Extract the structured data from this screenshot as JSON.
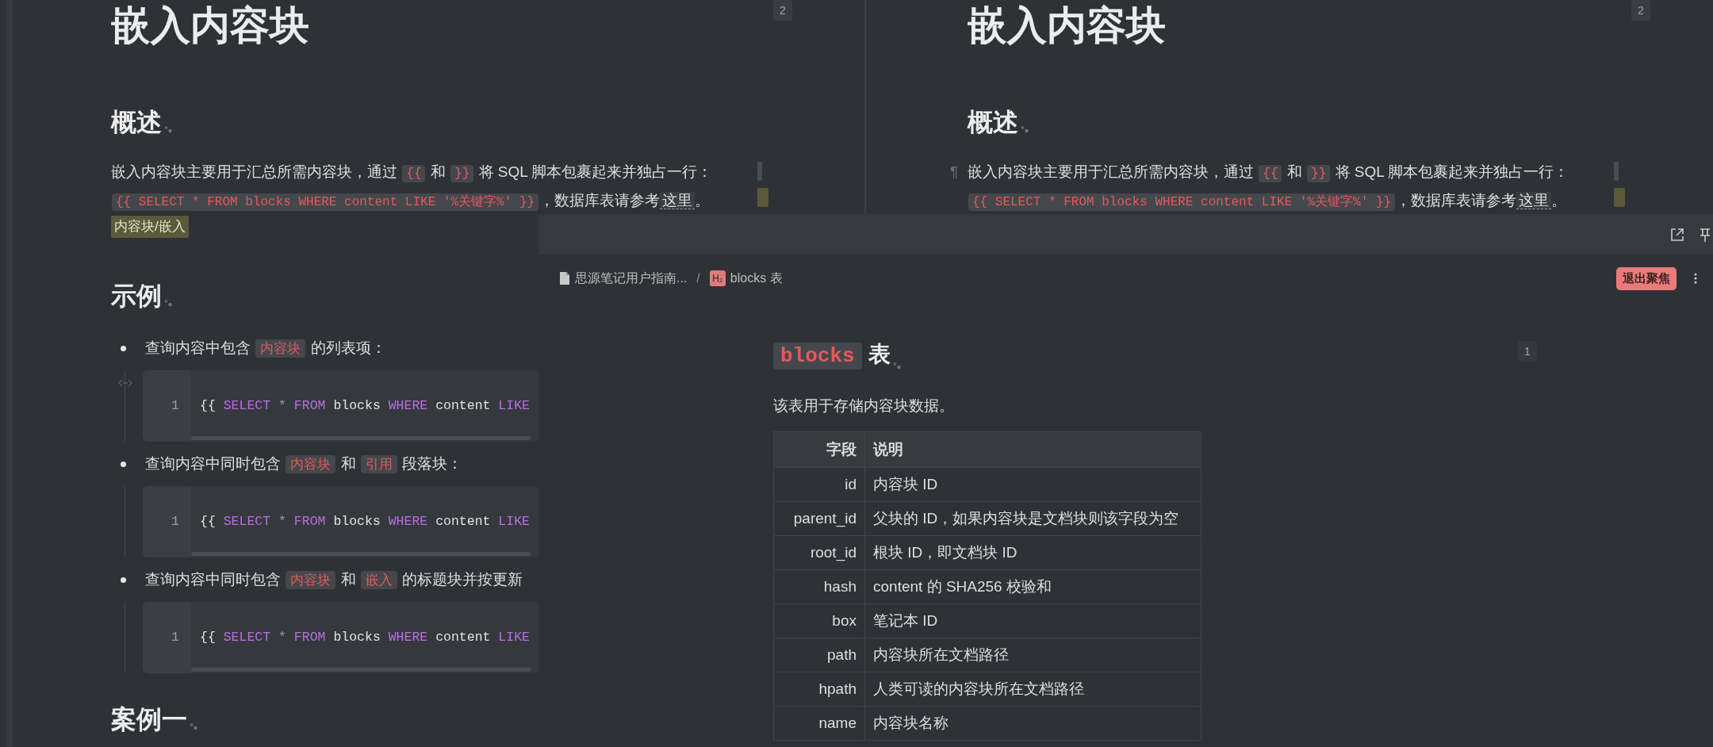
{
  "panes": [
    {
      "page_number": "2",
      "title": "嵌入内容块",
      "blocks": [
        {
          "kind": "heading",
          "text": "概述"
        },
        {
          "kind": "paragraph",
          "segments": [
            {
              "kind": "text",
              "text": "嵌入内容块主要用于汇总所需内容块，通过 "
            },
            {
              "kind": "code",
              "text": "{{"
            },
            {
              "kind": "text",
              "text": " 和 "
            },
            {
              "kind": "code",
              "text": "}}"
            },
            {
              "kind": "text",
              "text": " 将 SQL 脚本包裹起来并独占一行："
            },
            {
              "kind": "code",
              "text": "{{ SELECT * FROM blocks WHERE content LIKE '%关键字%' }}"
            },
            {
              "kind": "text",
              "text": "，数据库表请参考"
            },
            {
              "kind": "ref",
              "text": "这里"
            },
            {
              "kind": "text",
              "text": "。"
            }
          ],
          "markers": [
            {
              "kind": "block"
            },
            {
              "kind": "tag"
            }
          ]
        },
        {
          "kind": "tag",
          "text": "内容块/嵌入"
        },
        {
          "kind": "heading",
          "text": "示例"
        },
        {
          "kind": "list",
          "items": [
            {
              "hovered": true,
              "segments": [
                {
                  "kind": "text",
                  "text": "查询内容中包含 "
                },
                {
                  "kind": "code",
                  "text": "内容块"
                },
                {
                  "kind": "text",
                  "text": " 的列表项："
                }
              ],
              "code": {
                "line_number": "1",
                "tokens": [
                  {
                    "kind": "plain",
                    "text": "{{"
                  },
                  {
                    "kind": "keyword",
                    "text": "SELECT"
                  },
                  {
                    "kind": "operator",
                    "text": "*"
                  },
                  {
                    "kind": "keyword",
                    "text": "FROM"
                  },
                  {
                    "kind": "plain",
                    "text": "blocks"
                  },
                  {
                    "kind": "keyword",
                    "text": "WHERE"
                  },
                  {
                    "kind": "plain",
                    "text": "content"
                  },
                  {
                    "kind": "keyword",
                    "text": "LIKE"
                  }
                ]
              }
            },
            {
              "hovered": false,
              "segments": [
                {
                  "kind": "text",
                  "text": "查询内容中同时包含 "
                },
                {
                  "kind": "code",
                  "text": "内容块"
                },
                {
                  "kind": "text",
                  "text": " 和 "
                },
                {
                  "kind": "code",
                  "text": "引用"
                },
                {
                  "kind": "text",
                  "text": " 段落块："
                }
              ],
              "code": {
                "line_number": "1",
                "tokens": [
                  {
                    "kind": "plain",
                    "text": "{{"
                  },
                  {
                    "kind": "keyword",
                    "text": "SELECT"
                  },
                  {
                    "kind": "operator",
                    "text": "*"
                  },
                  {
                    "kind": "keyword",
                    "text": "FROM"
                  },
                  {
                    "kind": "plain",
                    "text": "blocks"
                  },
                  {
                    "kind": "keyword",
                    "text": "WHERE"
                  },
                  {
                    "kind": "plain",
                    "text": "content"
                  },
                  {
                    "kind": "keyword",
                    "text": "LIKE"
                  }
                ]
              }
            },
            {
              "hovered": false,
              "segments": [
                {
                  "kind": "text",
                  "text": "查询内容中同时包含 "
                },
                {
                  "kind": "code",
                  "text": "内容块"
                },
                {
                  "kind": "text",
                  "text": " 和 "
                },
                {
                  "kind": "code",
                  "text": "嵌入"
                },
                {
                  "kind": "text",
                  "text": " 的标题块并按更新"
                }
              ],
              "code": {
                "line_number": "1",
                "tokens": [
                  {
                    "kind": "plain",
                    "text": "{{"
                  },
                  {
                    "kind": "keyword",
                    "text": "SELECT"
                  },
                  {
                    "kind": "operator",
                    "text": "*"
                  },
                  {
                    "kind": "keyword",
                    "text": "FROM"
                  },
                  {
                    "kind": "plain",
                    "text": "blocks"
                  },
                  {
                    "kind": "keyword",
                    "text": "WHERE"
                  },
                  {
                    "kind": "plain",
                    "text": "content"
                  },
                  {
                    "kind": "keyword",
                    "text": "LIKE"
                  }
                ]
              }
            }
          ]
        },
        {
          "kind": "heading",
          "text": "案例一"
        }
      ]
    },
    {
      "page_number": "2",
      "title": "嵌入内容块",
      "blocks": [
        {
          "kind": "heading",
          "text": "概述"
        },
        {
          "kind": "paragraph",
          "gutter_mark": "¶",
          "segments": [
            {
              "kind": "text",
              "text": "嵌入内容块主要用于汇总所需内容块，通过 "
            },
            {
              "kind": "code",
              "text": "{{"
            },
            {
              "kind": "text",
              "text": " 和 "
            },
            {
              "kind": "code",
              "text": "}}"
            },
            {
              "kind": "text",
              "text": " 将 SQL 脚本包裹起来并独占一行："
            },
            {
              "kind": "code",
              "text": "{{ SELECT * FROM blocks WHERE content LIKE '%关键字%' }}"
            },
            {
              "kind": "text",
              "text": "，数据库表请参考"
            },
            {
              "kind": "ref",
              "text": "这里"
            },
            {
              "kind": "text",
              "text": "。"
            }
          ],
          "markers": [
            {
              "kind": "block"
            },
            {
              "kind": "tag"
            }
          ]
        }
      ]
    }
  ],
  "popup": {
    "breadcrumb": [
      {
        "kind": "document",
        "text": "思源笔记用户指南..."
      },
      {
        "kind": "separator",
        "text": "/"
      },
      {
        "kind": "heading",
        "icon_text": "H₂",
        "text": "blocks 表"
      }
    ],
    "exit_focus_button": "退出聚焦",
    "page_number": "1",
    "heading": {
      "code": "blocks",
      "text": "表"
    },
    "paragraph": "该表用于存储内容块数据。",
    "table": {
      "columns": [
        "字段",
        "说明"
      ],
      "rows": [
        [
          "id",
          "内容块 ID"
        ],
        [
          "parent_id",
          "父块的 ID，如果内容块是文档块则该字段为空"
        ],
        [
          "root_id",
          "根块 ID，即文档块 ID"
        ],
        [
          "hash",
          "content 的 SHA256 校验和"
        ],
        [
          "box",
          "笔记本 ID"
        ],
        [
          "path",
          "内容块所在文档路径"
        ],
        [
          "hpath",
          "人类可读的内容块所在文档路径"
        ],
        [
          "name",
          "内容块名称"
        ]
      ]
    }
  }
}
